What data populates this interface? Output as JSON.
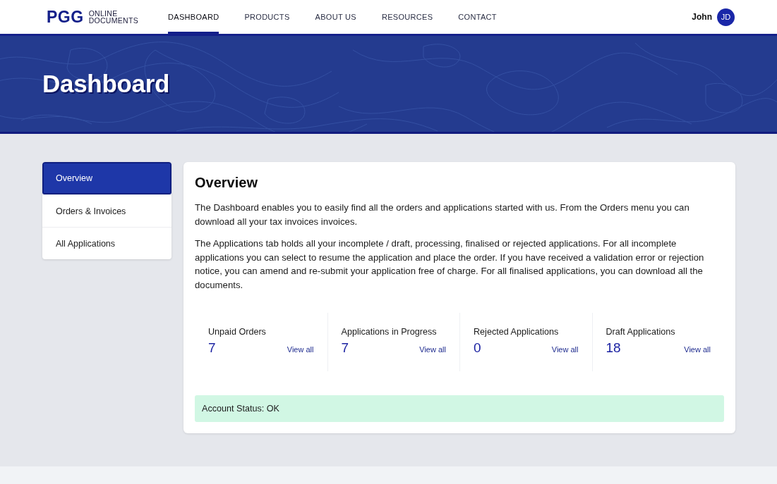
{
  "header": {
    "logo": {
      "mark": "PGG",
      "line_1": "ONLINE",
      "line_2": "DOCUMENTS"
    },
    "nav": [
      {
        "label": "DASHBOARD",
        "selected": true
      },
      {
        "label": "PRODUCTS",
        "selected": false
      },
      {
        "label": "ABOUT US",
        "selected": false
      },
      {
        "label": "RESOURCES",
        "selected": false
      },
      {
        "label": "CONTACT",
        "selected": false
      }
    ],
    "user": {
      "name": "John",
      "initials": "JD"
    }
  },
  "banner": {
    "title": "Dashboard"
  },
  "sidebar": {
    "items": [
      {
        "label": "Overview",
        "selected": true
      },
      {
        "label": "Orders & Invoices",
        "selected": false
      },
      {
        "label": "All Applications",
        "selected": false
      }
    ]
  },
  "overview": {
    "title": "Overview",
    "paragraphs": [
      "The Dashboard enables you to easily find all the orders and applications started with us. From the Orders menu you can download all your tax invoices invoices.",
      "The Applications tab holds all your incomplete / draft, processing, finalised or rejected applications. For all incomplete applications you can select to resume the application and place the order. If you have received a validation error or rejection notice, you can amend and re-submit your application free of charge. For all finalised applications, you can download all the documents."
    ],
    "stats": [
      {
        "label": "Unpaid Orders",
        "count": "7",
        "link": "View all"
      },
      {
        "label": "Applications in Progress",
        "count": "7",
        "link": "View all"
      },
      {
        "label": "Rejected Applications",
        "count": "0",
        "link": "View all"
      },
      {
        "label": "Draft Applications",
        "count": "18",
        "link": "View all"
      }
    ],
    "status": "Account Status: OK"
  }
}
